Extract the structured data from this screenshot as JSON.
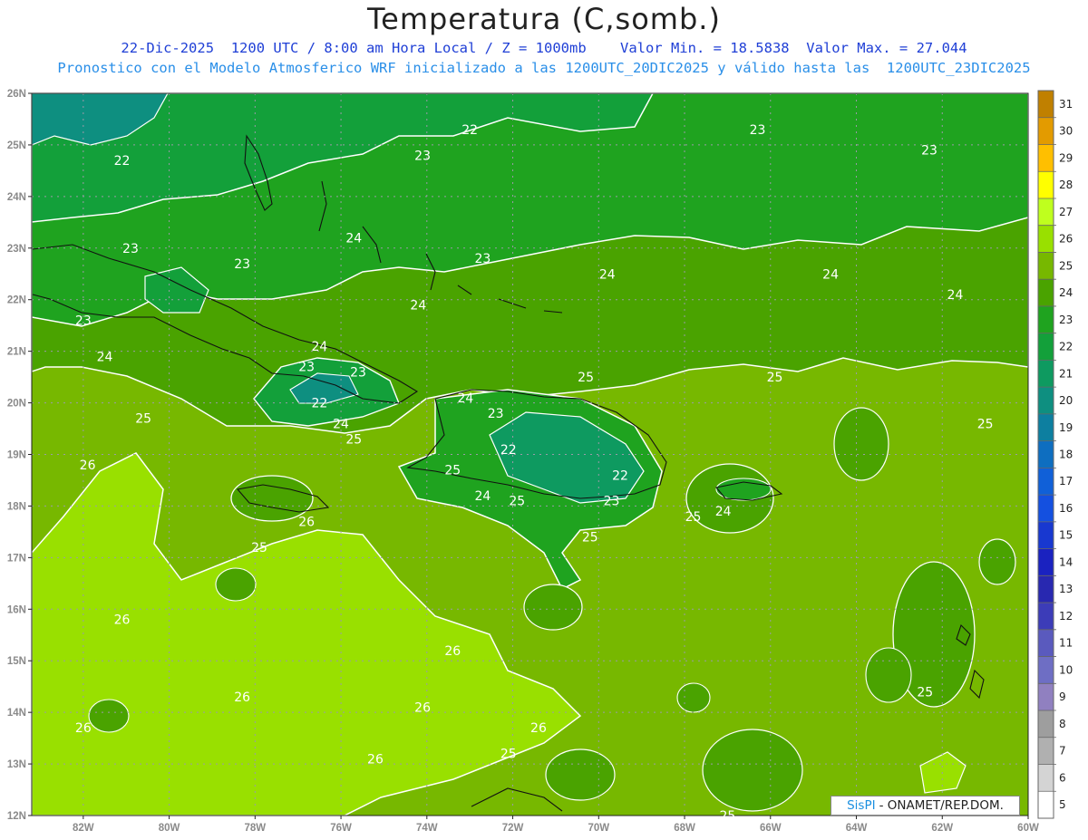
{
  "title": "Temperatura (C,somb.)",
  "subtitle_line1": "22-Dic-2025  1200 UTC / 8:00 am Hora Local / Z = 1000mb    Valor Min. = 18.5838  Valor Max. = 27.044",
  "subtitle_line2": "Pronostico con el Modelo Atmosferico WRF inicializado a las 1200UTC_20DIC2025 y válido hasta las  1200UTC_23DIC2025",
  "lat_labels": [
    "26N",
    "25N",
    "24N",
    "23N",
    "22N",
    "21N",
    "20N",
    "19N",
    "18N",
    "17N",
    "16N",
    "15N",
    "14N",
    "13N",
    "12N"
  ],
  "lon_labels": [
    "82W",
    "80W",
    "78W",
    "76W",
    "74W",
    "72W",
    "70W",
    "68W",
    "66W",
    "64W",
    "62W",
    "60W"
  ],
  "colorbar": {
    "labels": [
      "31",
      "30",
      "29",
      "28",
      "27",
      "26",
      "25",
      "24",
      "23",
      "22",
      "21",
      "20",
      "19",
      "18",
      "17",
      "16",
      "15",
      "14",
      "13",
      "12",
      "11",
      "10",
      "9",
      "8",
      "7",
      "6",
      "5"
    ],
    "colors": [
      "#c08000",
      "#e39b00",
      "#ffbf00",
      "#ffff00",
      "#bfff1e",
      "#99e000",
      "#77b800",
      "#4aa300",
      "#1fa31f",
      "#13a03a",
      "#0e9a60",
      "#0e8f80",
      "#0d7fa0",
      "#0e6ec0",
      "#1060d8",
      "#1450e0",
      "#1838d0",
      "#1a22c0",
      "#2828b0",
      "#3c3cb8",
      "#5a5abe",
      "#6e6ec4",
      "#9080c0",
      "#9e9e9e",
      "#b0b0b0",
      "#d4d4d4",
      "#ffffff"
    ]
  },
  "contour_labels": [
    {
      "text": "22",
      "lon": -81.1,
      "lat": 24.7
    },
    {
      "text": "22",
      "lon": -73.0,
      "lat": 25.3
    },
    {
      "text": "23",
      "lon": -74.1,
      "lat": 24.8
    },
    {
      "text": "23",
      "lon": -66.3,
      "lat": 25.3
    },
    {
      "text": "23",
      "lon": -62.3,
      "lat": 24.9
    },
    {
      "text": "23",
      "lon": -80.9,
      "lat": 23.0
    },
    {
      "text": "23",
      "lon": -78.3,
      "lat": 22.7
    },
    {
      "text": "23",
      "lon": -72.7,
      "lat": 22.8
    },
    {
      "text": "24",
      "lon": -75.7,
      "lat": 23.2
    },
    {
      "text": "24",
      "lon": -69.8,
      "lat": 22.5
    },
    {
      "text": "24",
      "lon": -64.6,
      "lat": 22.5
    },
    {
      "text": "24",
      "lon": -61.7,
      "lat": 22.1
    },
    {
      "text": "24",
      "lon": -74.2,
      "lat": 21.9
    },
    {
      "text": "23",
      "lon": -82.0,
      "lat": 21.6
    },
    {
      "text": "24",
      "lon": -81.5,
      "lat": 20.9
    },
    {
      "text": "24",
      "lon": -76.5,
      "lat": 21.1
    },
    {
      "text": "23",
      "lon": -76.8,
      "lat": 20.7
    },
    {
      "text": "23",
      "lon": -75.6,
      "lat": 20.6
    },
    {
      "text": "22",
      "lon": -76.5,
      "lat": 20.0
    },
    {
      "text": "24",
      "lon": -76.0,
      "lat": 19.6
    },
    {
      "text": "25",
      "lon": -75.7,
      "lat": 19.3
    },
    {
      "text": "25",
      "lon": -80.6,
      "lat": 19.7
    },
    {
      "text": "24",
      "lon": -73.1,
      "lat": 20.1
    },
    {
      "text": "23",
      "lon": -72.4,
      "lat": 19.8
    },
    {
      "text": "25",
      "lon": -70.3,
      "lat": 20.5
    },
    {
      "text": "25",
      "lon": -65.9,
      "lat": 20.5
    },
    {
      "text": "25",
      "lon": -61.0,
      "lat": 19.6
    },
    {
      "text": "22",
      "lon": -72.1,
      "lat": 19.1
    },
    {
      "text": "22",
      "lon": -69.5,
      "lat": 18.6
    },
    {
      "text": "23",
      "lon": -69.7,
      "lat": 18.1
    },
    {
      "text": "25",
      "lon": -73.4,
      "lat": 18.7
    },
    {
      "text": "24",
      "lon": -72.7,
      "lat": 18.2
    },
    {
      "text": "25",
      "lon": -71.9,
      "lat": 18.1
    },
    {
      "text": "26",
      "lon": -81.9,
      "lat": 18.8
    },
    {
      "text": "26",
      "lon": -76.8,
      "lat": 17.7
    },
    {
      "text": "25",
      "lon": -77.9,
      "lat": 17.2
    },
    {
      "text": "25",
      "lon": -70.2,
      "lat": 17.4
    },
    {
      "text": "25",
      "lon": -67.8,
      "lat": 17.8
    },
    {
      "text": "24",
      "lon": -67.1,
      "lat": 17.9
    },
    {
      "text": "26",
      "lon": -81.1,
      "lat": 15.8
    },
    {
      "text": "26",
      "lon": -73.4,
      "lat": 15.2
    },
    {
      "text": "26",
      "lon": -78.3,
      "lat": 14.3
    },
    {
      "text": "26",
      "lon": -74.1,
      "lat": 14.1
    },
    {
      "text": "26",
      "lon": -82.0,
      "lat": 13.7
    },
    {
      "text": "26",
      "lon": -71.4,
      "lat": 13.7
    },
    {
      "text": "26",
      "lon": -75.2,
      "lat": 13.1
    },
    {
      "text": "25",
      "lon": -72.1,
      "lat": 13.2
    },
    {
      "text": "25",
      "lon": -62.4,
      "lat": 14.4
    },
    {
      "text": "25",
      "lon": -67.0,
      "lat": 12.0
    }
  ],
  "credit": {
    "brand": "SisPI",
    "text": " - ONAMET/REP.DOM."
  }
}
